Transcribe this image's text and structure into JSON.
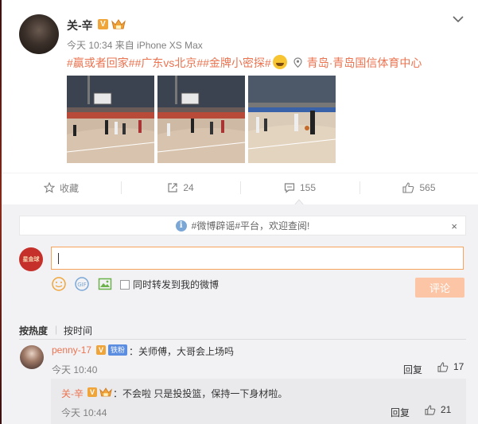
{
  "post": {
    "username": "关-辛",
    "verified_badge": "V",
    "meta": "今天 10:34 来自 iPhone XS Max",
    "hashtags": "#赢或者回家##广东vs北京##金牌小密探#",
    "location": "青岛·青岛国信体育中心",
    "images": [
      "basketball-practice-1",
      "basketball-practice-2",
      "basketball-practice-3"
    ]
  },
  "actions": {
    "favorite_label": "收藏",
    "repost_count": "24",
    "comment_count": "155",
    "like_count": "565"
  },
  "comments_panel": {
    "notice": "#微博辟谣#平台，欢迎查阅!",
    "notice_close": "×",
    "my_avatar_text": "星金球",
    "input_value": "",
    "forward_label": "同时转发到我的微博",
    "submit_label": "评论",
    "sort_hot": "按热度",
    "sort_time": "按时间",
    "sort_separator": "|"
  },
  "comments": [
    {
      "username": "penny-17",
      "verified_badge": "V",
      "fan_badge": "铁粉",
      "text": "：关师傅，大哥会上场吗",
      "time": "今天 10:40",
      "reply_label": "回复",
      "likes": "17",
      "reply": {
        "username": "关-辛",
        "verified_badge": "V",
        "text": "：不会啦 只是投投篮，保持一下身材啦。",
        "time": "今天 10:44",
        "reply_label": "回复",
        "likes": "21"
      }
    }
  ],
  "colors": {
    "accent": "#eb7350",
    "badge_gold": "#f0a53a",
    "fan_badge_blue": "#5b8de1",
    "submit_disabled": "#fcc5a6"
  }
}
